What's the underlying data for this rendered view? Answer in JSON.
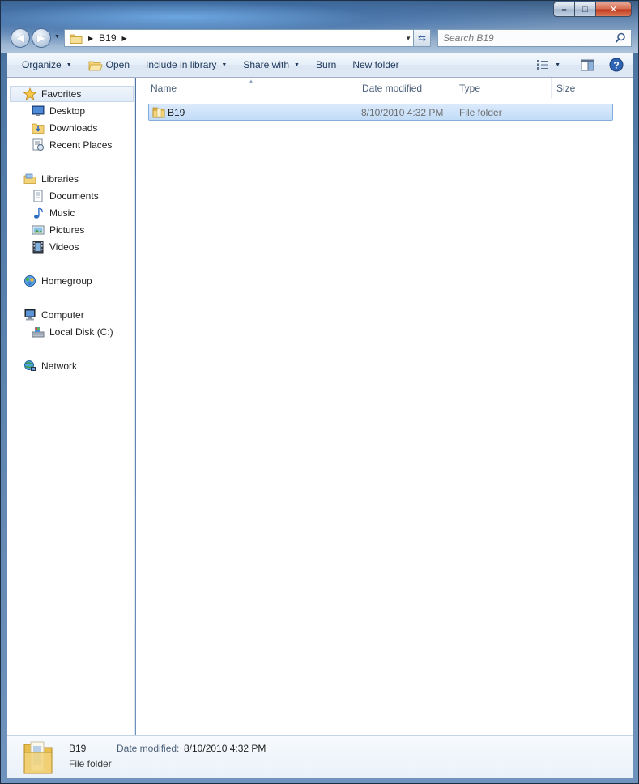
{
  "window": {
    "controls": {
      "minimize": "–",
      "maximize": "□",
      "close": "✕"
    }
  },
  "address": {
    "crumbs": [
      "B19"
    ],
    "search_placeholder": "Search B19"
  },
  "toolbar": {
    "organize": "Organize",
    "open": "Open",
    "include_in_library": "Include in library",
    "share_with": "Share with",
    "burn": "Burn",
    "new_folder": "New folder"
  },
  "nav_pane": {
    "favorites": {
      "label": "Favorites",
      "items": [
        "Desktop",
        "Downloads",
        "Recent Places"
      ]
    },
    "libraries": {
      "label": "Libraries",
      "items": [
        "Documents",
        "Music",
        "Pictures",
        "Videos"
      ]
    },
    "homegroup": {
      "label": "Homegroup"
    },
    "computer": {
      "label": "Computer",
      "items": [
        "Local Disk (C:)"
      ]
    },
    "network": {
      "label": "Network"
    }
  },
  "columns": {
    "name": "Name",
    "date_modified": "Date modified",
    "type": "Type",
    "size": "Size"
  },
  "files": [
    {
      "name": "B19",
      "date_modified": "8/10/2010 4:32 PM",
      "type": "File folder",
      "size": ""
    }
  ],
  "details": {
    "name": "B19",
    "type": "File folder",
    "date_label": "Date modified:",
    "date_value": "8/10/2010 4:32 PM"
  },
  "colors": {
    "toolbar_text": "#1e395b",
    "selection_fill": "#c2dcf8",
    "selection_border": "#84acdd",
    "folder_yellow": "#f3d47a"
  }
}
